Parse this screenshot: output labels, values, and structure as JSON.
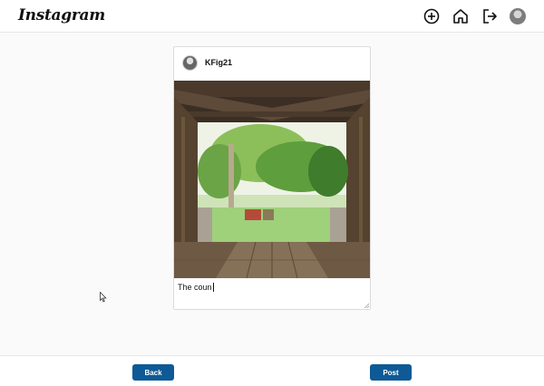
{
  "header": {
    "logo_text": "Instagram"
  },
  "nav": {
    "icons": [
      "add-icon",
      "home-icon",
      "logout-icon",
      "profile-avatar"
    ]
  },
  "post": {
    "username": "KFig21",
    "caption_value": "The coun"
  },
  "footer": {
    "back_label": "Back",
    "post_label": "Post"
  },
  "colors": {
    "button_blue": "#0e5a96",
    "background": "#fafafa"
  }
}
